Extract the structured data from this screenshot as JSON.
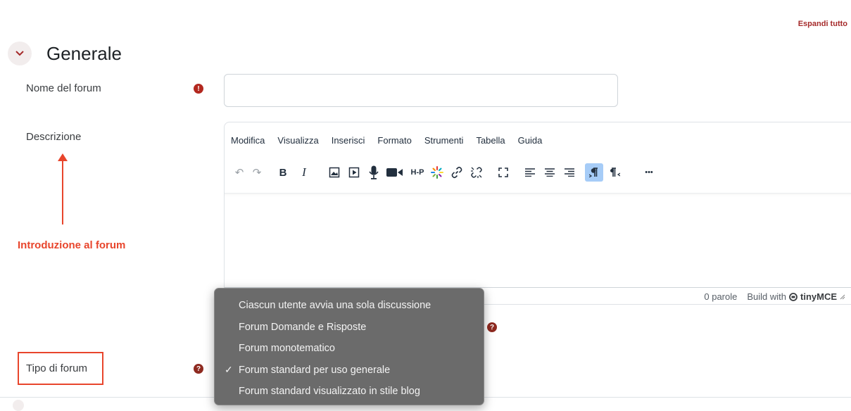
{
  "header": {
    "expand_all": "Espandi tutto"
  },
  "section": {
    "title": "Generale"
  },
  "fields": {
    "forum_name": {
      "label": "Nome del forum",
      "value": ""
    },
    "description": {
      "label": "Descrizione"
    },
    "forum_type": {
      "label": "Tipo di forum"
    }
  },
  "editor": {
    "menu": [
      "Modifica",
      "Visualizza",
      "Inserisci",
      "Formato",
      "Strumenti",
      "Tabella",
      "Guida"
    ],
    "word_count": "0 parole",
    "branding_prefix": "Build with",
    "branding_name": "tinyMCE"
  },
  "annotation": {
    "text": "Introduzione al forum",
    "color": "#e8452c"
  },
  "dropdown": {
    "options": [
      "Ciascun utente avvia una sola discussione",
      "Forum Domande e Risposte",
      "Forum monotematico",
      "Forum standard per uso generale",
      "Forum standard visualizzato in stile blog"
    ],
    "selected": "Forum standard per uso generale"
  },
  "icons": {
    "required": "!",
    "help": "?",
    "check": "✓",
    "tb_undo": "↶",
    "tb_redo": "↷",
    "tb_bold": "B",
    "tb_italic": "I",
    "tb_h5p": "H-P",
    "tb_more": "•••"
  },
  "colors": {
    "accent": "#a52a2a",
    "required": "#b3281f",
    "selected_tool": "#a6ccf7"
  }
}
